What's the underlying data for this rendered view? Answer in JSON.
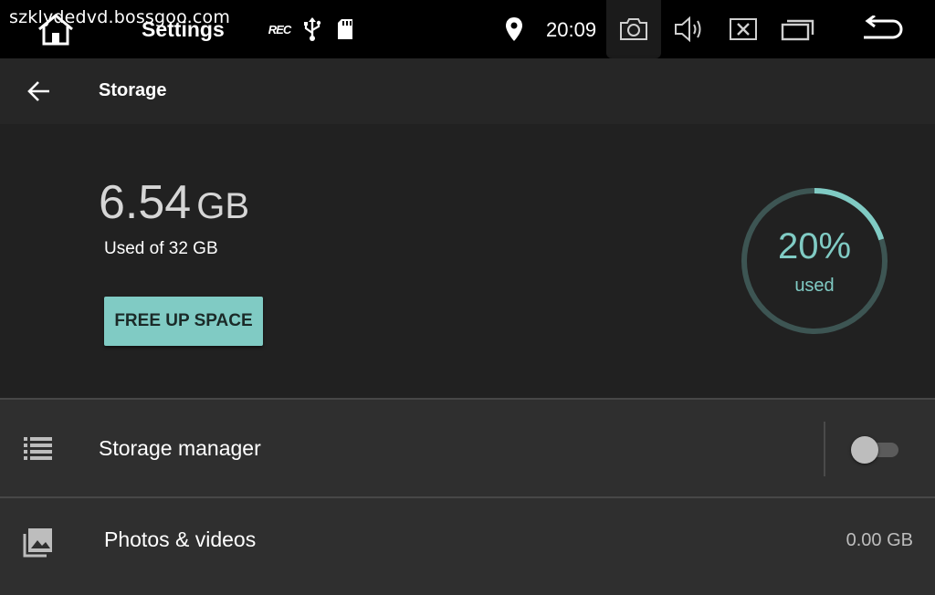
{
  "statusbar": {
    "watermark": "szklydedvd.bossgoo.com",
    "title": "Settings",
    "rec_label": "REC",
    "time": "20:09",
    "icons": [
      "home-icon",
      "rec-icon",
      "usb-icon",
      "sd-card-icon",
      "location-icon",
      "camera-icon",
      "volume-icon",
      "close-icon",
      "recents-icon",
      "back-icon"
    ]
  },
  "appbar": {
    "title": "Storage"
  },
  "summary": {
    "used_value": "6.54",
    "used_unit": "GB",
    "used_of": "Used of 32 GB",
    "free_button": "FREE UP SPACE",
    "percent_text": "20%",
    "percent_label": "used",
    "percent_fraction": 0.2,
    "accent_color": "#80cbc4",
    "ring_track_color": "#3d5553"
  },
  "list": {
    "storage_manager": {
      "label": "Storage manager",
      "toggle_on": false
    },
    "photos": {
      "label": "Photos & videos",
      "value": "0.00 GB"
    }
  }
}
